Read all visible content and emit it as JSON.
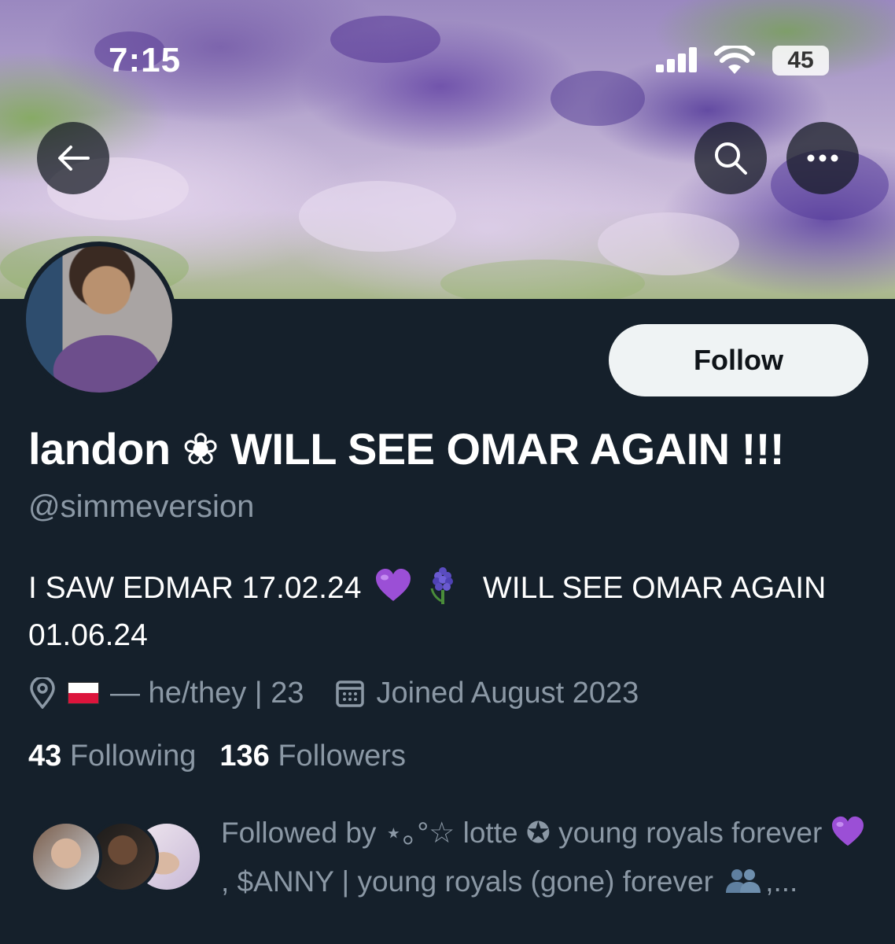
{
  "status_bar": {
    "time": "7:15",
    "battery": "45"
  },
  "profile": {
    "display_name": "landon ❀ WILL SEE OMAR AGAIN !!!",
    "handle": "@simmeversion",
    "follow_label": "Follow",
    "bio_part1": "I SAW EDMAR 17.02.24",
    "bio_part2": "WILL SEE OMAR AGAIN 01.06.24",
    "location_text": "— he/they | 23",
    "joined_text": "Joined August 2023",
    "following_count": "43",
    "following_label": "Following",
    "followers_count": "136",
    "followers_label": "Followers",
    "followed_by_part1": "Followed by ⋆｡°☆ lotte ✪ young royals forever",
    "followed_by_part2": ", $ANNY | young royals (gone) forever",
    "followed_by_part3": ",..."
  },
  "icons": {
    "back": "arrow-left-icon",
    "search": "search-icon",
    "more": "more-horizontal-icon",
    "location": "location-pin-icon",
    "calendar": "calendar-icon",
    "flag": "poland-flag-icon",
    "heart": "purple-heart-icon",
    "hyacinth": "hyacinth-icon",
    "people": "people-silhouette-icon"
  },
  "colors": {
    "background": "#15202b",
    "secondary_text": "#8b98a5",
    "follow_button": "#eff3f4",
    "heart": "#9b4fd6"
  }
}
